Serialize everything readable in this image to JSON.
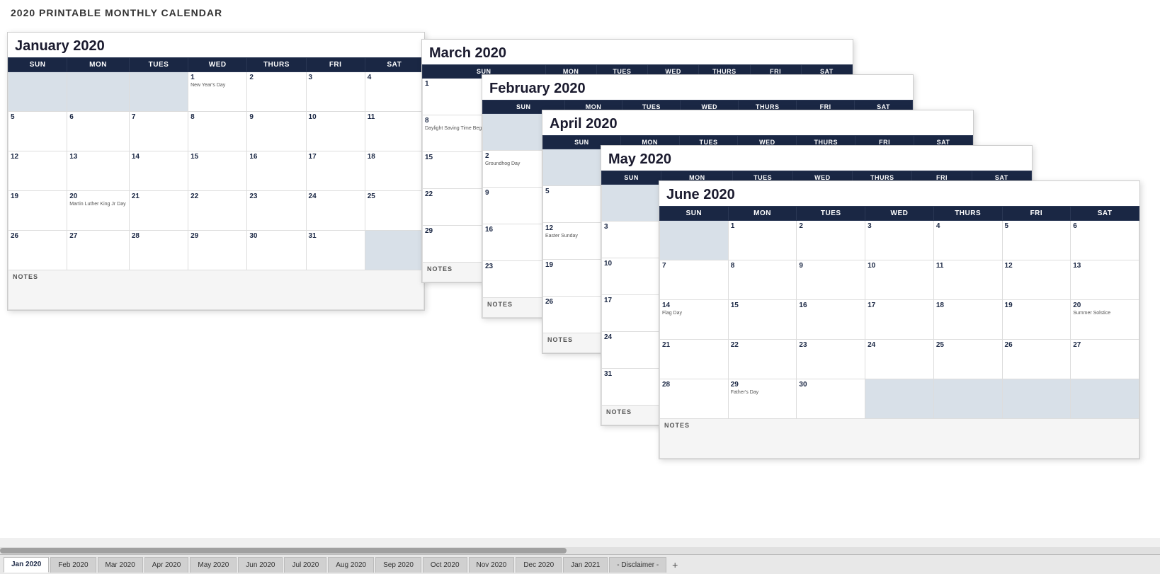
{
  "page": {
    "title": "2020 PRINTABLE MONTHLY CALENDAR"
  },
  "tabs": [
    {
      "label": "Jan 2020",
      "active": true
    },
    {
      "label": "Feb 2020",
      "active": false
    },
    {
      "label": "Mar 2020",
      "active": false
    },
    {
      "label": "Apr 2020",
      "active": false
    },
    {
      "label": "May 2020",
      "active": false
    },
    {
      "label": "Jun 2020",
      "active": false
    },
    {
      "label": "Jul 2020",
      "active": false
    },
    {
      "label": "Aug 2020",
      "active": false
    },
    {
      "label": "Sep 2020",
      "active": false
    },
    {
      "label": "Oct 2020",
      "active": false
    },
    {
      "label": "Nov 2020",
      "active": false
    },
    {
      "label": "Dec 2020",
      "active": false
    },
    {
      "label": "Jan 2021",
      "active": false
    },
    {
      "label": "- Disclaimer -",
      "active": false
    }
  ],
  "calendars": {
    "january": {
      "title": "January 2020",
      "days_header": [
        "SUN",
        "MON",
        "TUES",
        "WED",
        "THURS",
        "FRI",
        "SAT"
      ]
    },
    "march": {
      "title": "March 2020",
      "days_header": [
        "SUN",
        "MON",
        "TUES",
        "WED",
        "THURS",
        "FRI",
        "SAT"
      ]
    },
    "february": {
      "title": "February 2020",
      "days_header": [
        "SUN",
        "MON",
        "TUES",
        "WED",
        "THURS",
        "FRI",
        "SAT"
      ]
    },
    "april": {
      "title": "April 2020",
      "days_header": [
        "SUN",
        "MON",
        "TUES",
        "WED",
        "THURS",
        "FRI",
        "SAT"
      ]
    },
    "may": {
      "title": "May 2020",
      "days_header": [
        "SUN",
        "MON",
        "TUES",
        "WED",
        "THURS",
        "FRI",
        "SAT"
      ]
    },
    "june": {
      "title": "June 2020",
      "days_header": [
        "SUN",
        "MON",
        "TUES",
        "WED",
        "THURS",
        "FRI",
        "SAT"
      ]
    }
  },
  "notes_label": "NOTES"
}
